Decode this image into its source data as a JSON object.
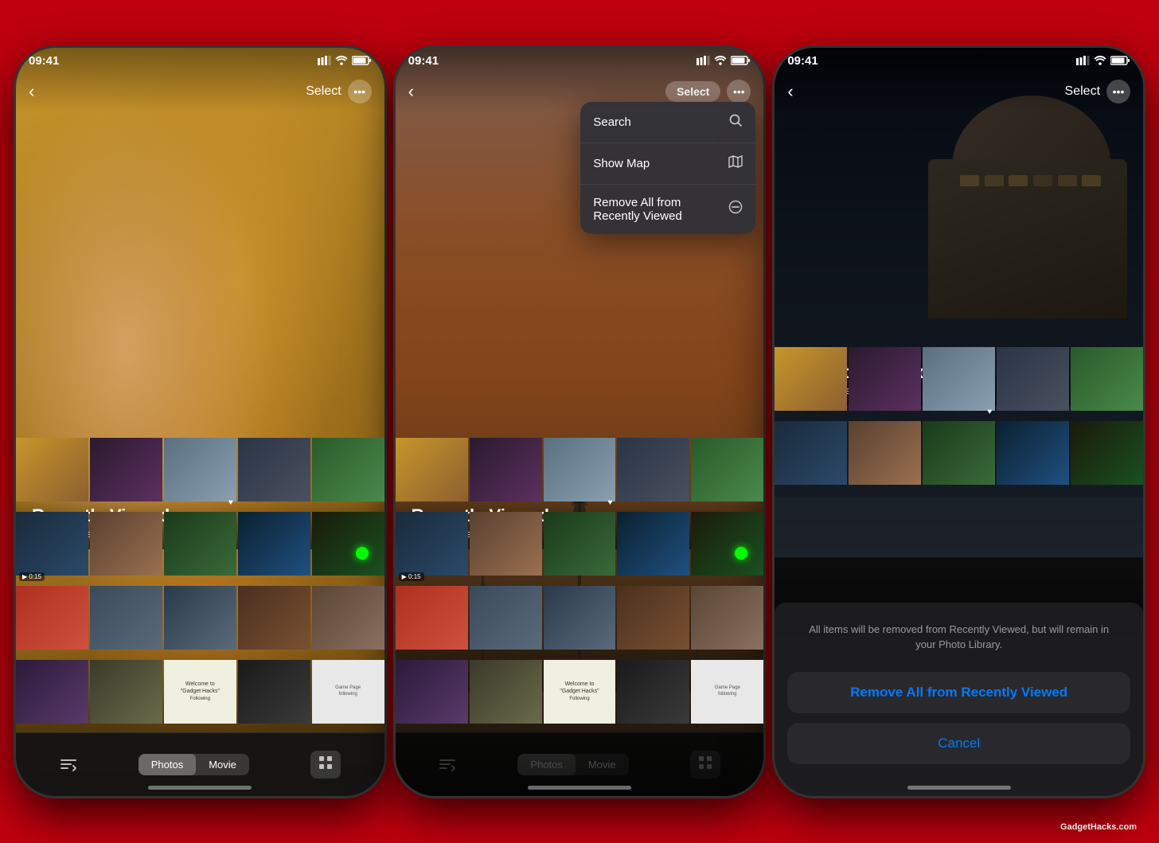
{
  "brand": "GadgetHacks.com",
  "screens": [
    {
      "id": "screen1",
      "time": "09:41",
      "title": "Recently Viewed",
      "itemCount": "200 Items",
      "backLabel": "‹",
      "selectLabel": "Select",
      "moreLabel": "•••",
      "hasDropdown": false,
      "hasDialog": false,
      "segOptions": [
        "Photos",
        "Movie"
      ],
      "activeSegIndex": 0,
      "thumbColors": [
        "#c8952a",
        "#2a1a2e",
        "#6a8a9a",
        "#3a4a5a",
        "#2a4a2a",
        "#1a3a5a",
        "#6a4a2a",
        "#1a3a1a",
        "#8a2020",
        "#5a6a7a",
        "#1a1a3a",
        "#2a1a1a",
        "#b03020",
        "#4a5a6a",
        "#2a4a6a",
        "#4a3a2a",
        "#2a1a3a",
        "#3a4a3a",
        "#5a3a2a",
        "#2a5a2a"
      ]
    },
    {
      "id": "screen2",
      "time": "09:41",
      "title": "Recently Viewed",
      "itemCount": "200 Items",
      "backLabel": "‹",
      "selectLabel": "Select",
      "moreLabel": "•••",
      "hasDropdown": true,
      "hasDialog": false,
      "dropdownItems": [
        {
          "label": "Search",
          "icon": "🔍"
        },
        {
          "label": "Show Map",
          "icon": "🗺"
        },
        {
          "label": "Remove All from\nRecently Viewed",
          "icon": "⊖"
        }
      ],
      "segOptions": [
        "Photos",
        "Movie"
      ],
      "activeSegIndex": 0
    },
    {
      "id": "screen3",
      "time": "09:41",
      "title": "Recently Viewed",
      "itemCount": "200 Items",
      "backLabel": "‹",
      "selectLabel": "Select",
      "moreLabel": "•••",
      "hasDropdown": false,
      "hasDialog": true,
      "dialogMessage": "All items will be removed from Recently Viewed, but will remain in your Photo Library.",
      "dialogConfirmLabel": "Remove All from Recently Viewed",
      "dialogCancelLabel": "Cancel"
    }
  ]
}
